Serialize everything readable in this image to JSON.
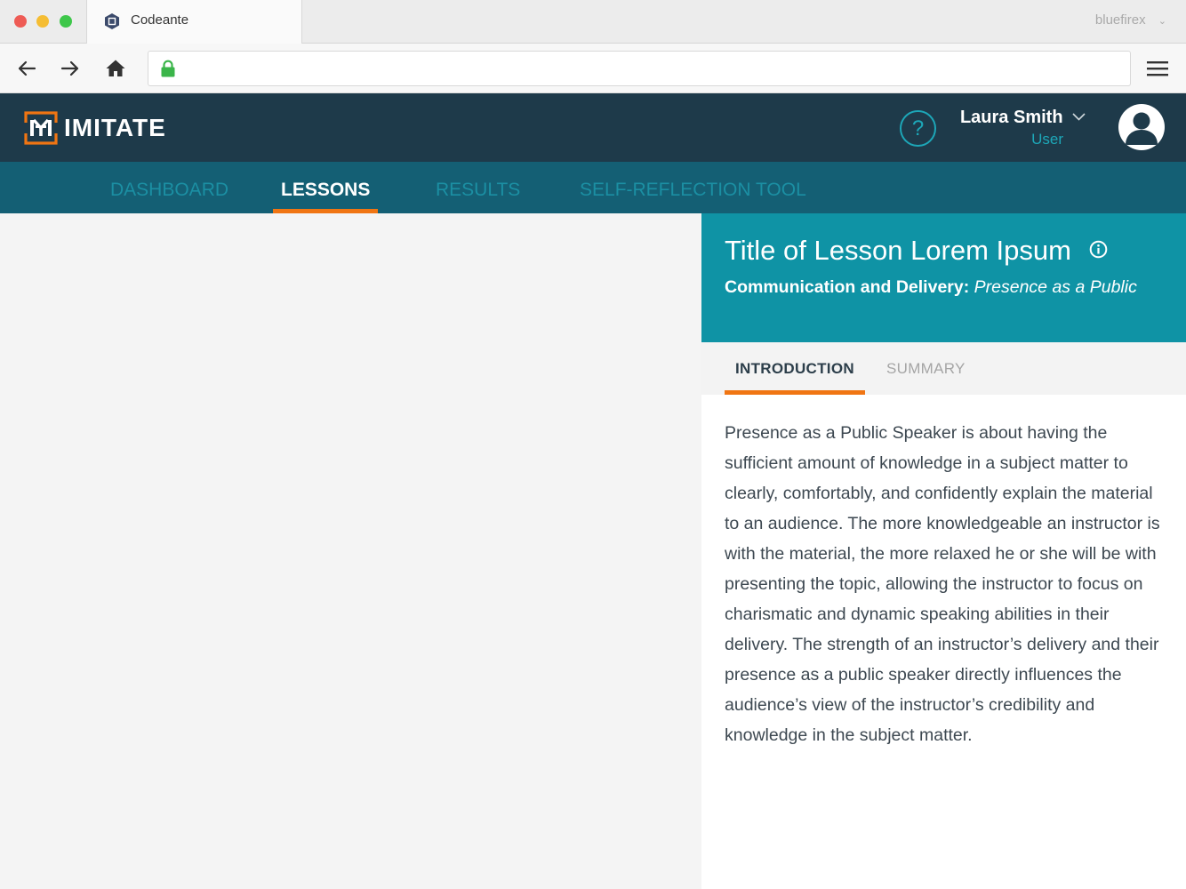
{
  "browser": {
    "tab_title": "Codeante",
    "profile": "bluefirex",
    "url": ""
  },
  "app": {
    "logo_text": "IMITATE",
    "user_name": "Laura Smith",
    "user_role": "User",
    "help": "?"
  },
  "nav": {
    "items": [
      {
        "label": "DASHBOARD",
        "active": false
      },
      {
        "label": "LESSONS",
        "active": true
      },
      {
        "label": "RESULTS",
        "active": false
      },
      {
        "label": "SELF-REFLECTION TOOL",
        "active": false
      }
    ]
  },
  "lesson": {
    "title": "Title of Lesson Lorem Ipsum",
    "category": "Communication and Delivery:",
    "topic": "Presence as a Public",
    "tabs": [
      {
        "label": "INTRODUCTION",
        "active": true
      },
      {
        "label": "SUMMARY",
        "active": false
      }
    ],
    "body": "Presence as a Public Speaker is about having the sufficient amount of knowledge in a subject matter to clearly, comfortably, and confidently explain the material to an audience. The more knowledgeable an instructor is with the material, the more relaxed he or she will be with presenting the topic, allowing the instructor to focus on charismatic and dynamic speaking abilities in their delivery. The strength of an instructor’s delivery and their presence as a public speaker directly influences the audience’s view of the instructor’s credibility and knowledge in the subject matter."
  },
  "colors": {
    "header": "#1e3a4a",
    "nav": "#145f74",
    "accent": "#f07513",
    "teal": "#0f93a5"
  }
}
